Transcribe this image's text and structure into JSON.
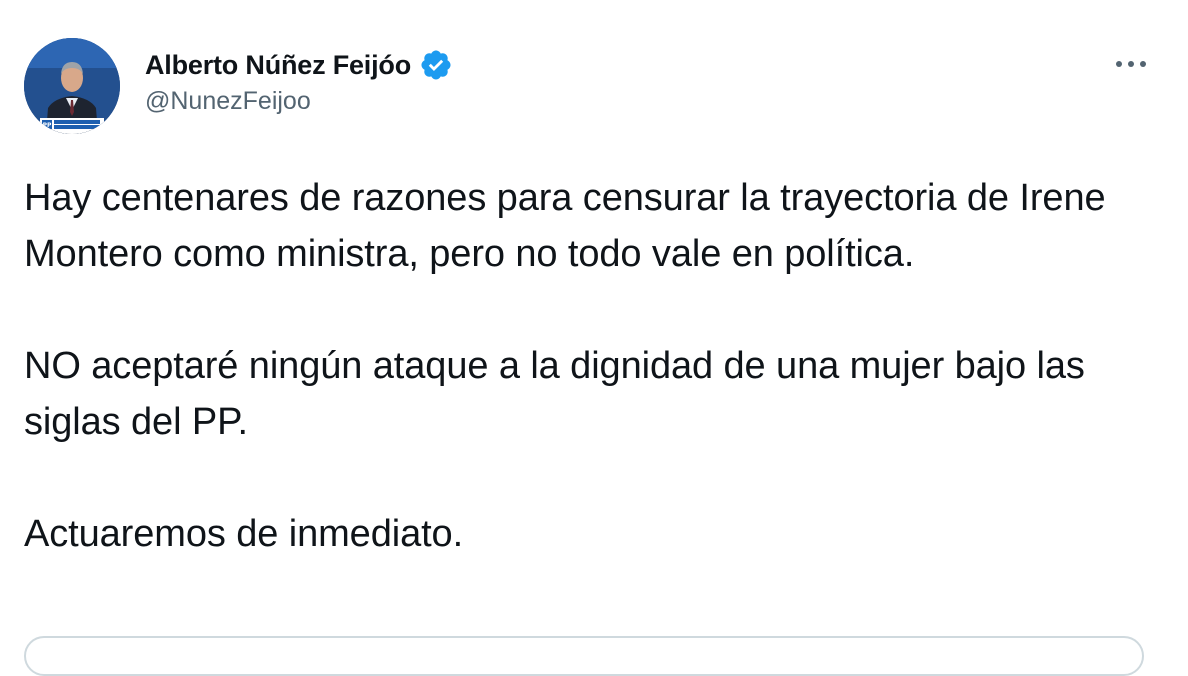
{
  "author": {
    "name": "Alberto Núñez Feijóo",
    "handle": "@NunezFeijoo",
    "avatar_banner": "A LA ALTURA DE UN GRAN PAÍS",
    "avatar_logo": "PP"
  },
  "tweet": {
    "paragraph_1": "Hay centenares de razones para censurar la trayectoria de Irene Montero como ministra, pero no todo vale en política.",
    "paragraph_2": "NO aceptaré ningún ataque a la dignidad de una mujer bajo las siglas del PP.",
    "paragraph_3": "Actuaremos de inmediato."
  },
  "icons": {
    "verified": "verified-badge-icon",
    "more": "more-options-icon"
  },
  "colors": {
    "verified_blue": "#1d9bf0",
    "text": "#0f1419",
    "secondary": "#536471",
    "border": "#cfd9de"
  }
}
